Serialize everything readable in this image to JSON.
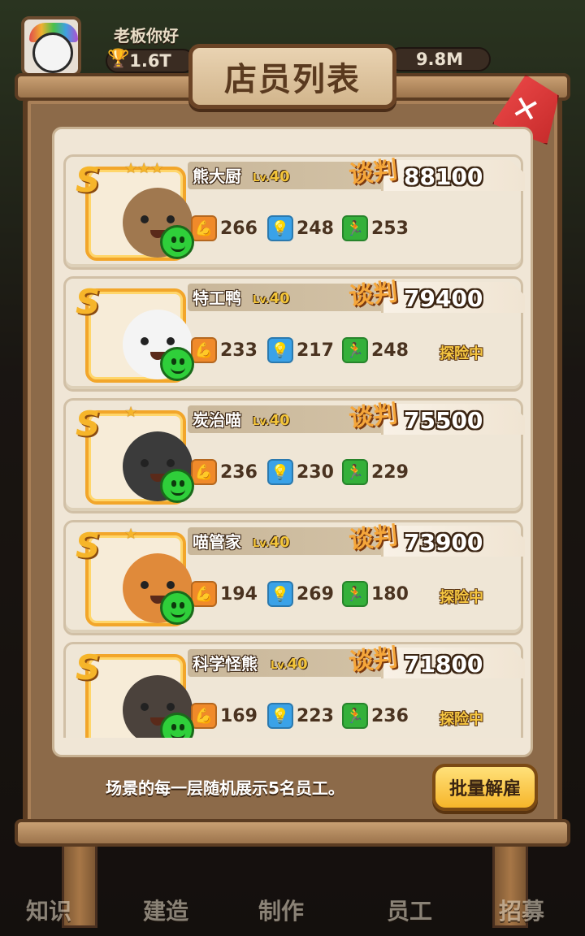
{
  "hud": {
    "greeting": "老板你好",
    "trophy_value": "1.6T",
    "currency_value": "9.8M"
  },
  "dialog": {
    "title": "店员列表",
    "footer_text": "场景的每一层随机展示5名员工。",
    "batch_button": "批量解雇",
    "negotiate_label": "谈判",
    "level_prefix": "Lv.",
    "rank_label": "S"
  },
  "staff": [
    {
      "name": "熊大厨",
      "level": "40",
      "price": "88100",
      "str": "266",
      "int": "248",
      "agi": "253",
      "status": "",
      "stars": "★★★",
      "color": "#a0784f"
    },
    {
      "name": "特工鸭",
      "level": "40",
      "price": "79400",
      "str": "233",
      "int": "217",
      "agi": "248",
      "status": "探险中",
      "stars": "",
      "color": "#f4f4f4"
    },
    {
      "name": "炭治喵",
      "level": "40",
      "price": "75500",
      "str": "236",
      "int": "230",
      "agi": "229",
      "status": "",
      "stars": "★",
      "color": "#3b3b3b"
    },
    {
      "name": "喵管家",
      "level": "40",
      "price": "73900",
      "str": "194",
      "int": "269",
      "agi": "180",
      "status": "探险中",
      "stars": "★",
      "color": "#e08a3a"
    },
    {
      "name": "科学怪熊",
      "level": "40",
      "price": "71800",
      "str": "169",
      "int": "223",
      "agi": "236",
      "status": "探险中",
      "stars": "",
      "color": "#4b423c"
    }
  ],
  "bottom_nav": [
    "知识",
    "建造",
    "制作",
    "员工",
    "招募"
  ],
  "icons": {
    "strength": "strength-icon",
    "intellect": "lightbulb-icon",
    "agility": "running-icon",
    "mood": "happy-face-icon",
    "close": "close-icon"
  }
}
